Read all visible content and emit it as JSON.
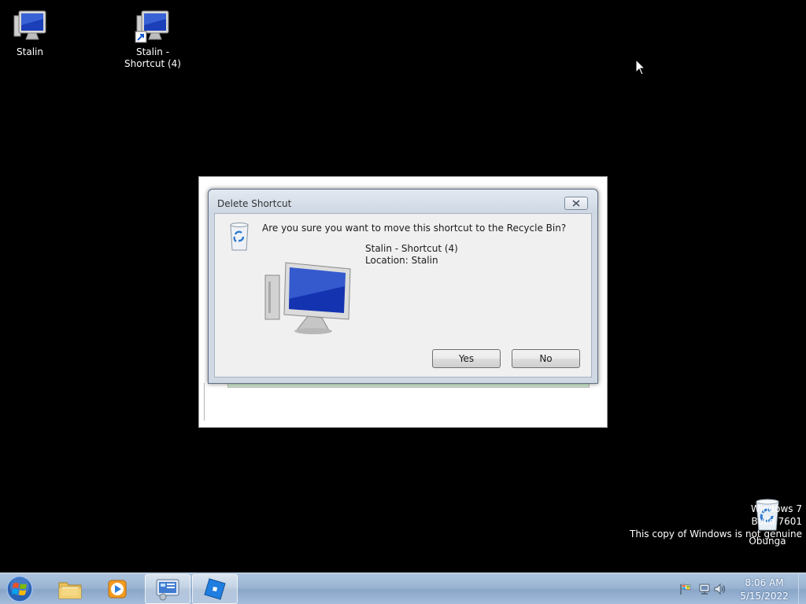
{
  "desktop": {
    "icons": [
      {
        "label": "Stalin",
        "type": "computer-icon"
      },
      {
        "label": "Stalin - Shortcut (4)",
        "type": "computer-shortcut-icon"
      },
      {
        "label": "Obunga",
        "type": "recycle-bin-icon"
      }
    ]
  },
  "watermark": {
    "line1": "Windows 7",
    "line2": "Build 7601",
    "line3": "This copy of Windows is not genuine"
  },
  "dialog": {
    "title": "Delete Shortcut",
    "question": "Are you sure you want to move this shortcut to the Recycle Bin?",
    "item_name": "Stalin - Shortcut (4)",
    "item_location": "Location: Stalin",
    "yes_label": "Yes",
    "no_label": "No"
  },
  "taskbar": {
    "buttons": [
      {
        "name": "windows-explorer",
        "icon": "folder-icon"
      },
      {
        "name": "media-player",
        "icon": "media-player-icon"
      },
      {
        "name": "control-panel",
        "icon": "control-panel-icon",
        "active": true
      },
      {
        "name": "app",
        "icon": "blue-app-icon",
        "active": true
      }
    ],
    "clock_time": "8:06 AM",
    "clock_date": "5/15/2022"
  },
  "colors": {
    "taskbar": "#9ab4d2",
    "dialog_frame": "#cfd8e3",
    "desktop": "#000000"
  }
}
